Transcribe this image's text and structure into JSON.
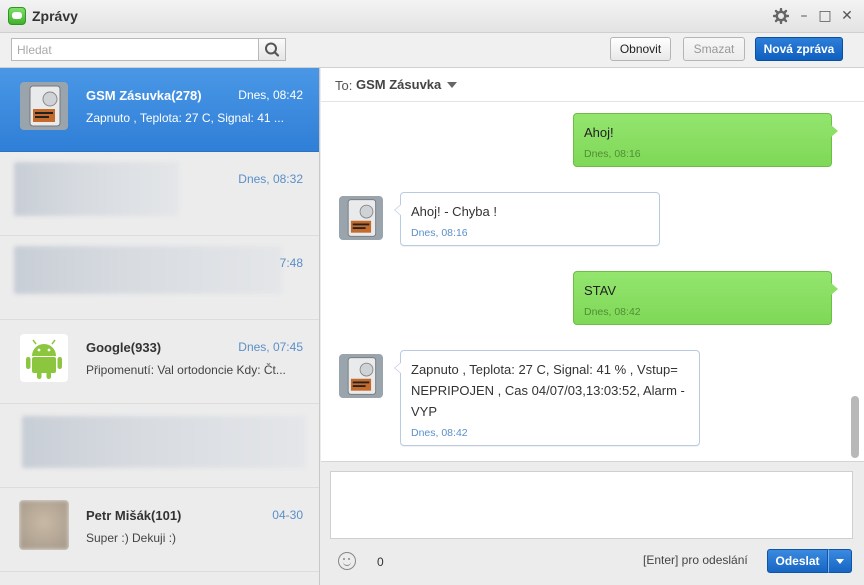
{
  "window": {
    "title": "Zprávy",
    "controls": {
      "settings_icon": "gear-icon",
      "minimize": "–",
      "maximize": "□",
      "close": "✕"
    }
  },
  "toolbar": {
    "search_placeholder": "Hledat",
    "refresh_label": "Obnovit",
    "delete_label": "Smazat",
    "new_message_label": "Nová zpráva"
  },
  "conversations": [
    {
      "name": "GSM Zásuvka(278)",
      "time": "Dnes, 08:42",
      "preview": "Zapnuto , Teplota: 27 C, Signal: 41 ...",
      "selected": true
    },
    {
      "name": "",
      "time": "Dnes, 08:32",
      "preview": "",
      "blurred": true
    },
    {
      "name": "",
      "time": "7:48",
      "preview": "",
      "blurred": true
    },
    {
      "name": "Google(933)",
      "time": "Dnes, 07:45",
      "preview": "Připomenutí: Val ortodoncie Kdy: Čt...",
      "avatar_icon": "android-icon"
    },
    {
      "name": "",
      "time": "",
      "preview": "",
      "blurred": true
    },
    {
      "name": "Petr Mišák(101)",
      "time": "04-30",
      "preview": "Super :) Dekuji :)"
    }
  ],
  "chat": {
    "to_label": "To:",
    "to_name": "GSM Zásuvka",
    "messages": [
      {
        "direction": "out",
        "text": "Ahoj!",
        "time": "Dnes, 08:16"
      },
      {
        "direction": "in",
        "text": "Ahoj! - Chyba !",
        "time": "Dnes, 08:16"
      },
      {
        "direction": "out",
        "text": "STAV",
        "time": "Dnes, 08:42"
      },
      {
        "direction": "in",
        "lines": [
          "Zapnuto , Teplota: 27 C, Signal: 41 % , Vstup=",
          "NEPRIPOJEN , Cas 04/07/03,13:03:52, Alarm -",
          "VYP"
        ],
        "time": "Dnes, 08:42"
      }
    ]
  },
  "compose": {
    "value": "",
    "char_count": "0",
    "send_hint": "[Enter] pro odeslání",
    "send_label": "Odeslat"
  },
  "colors": {
    "accent": "#2f7fd7",
    "outgoing_bubble": "#86dd60",
    "incoming_border": "#b9cbe0",
    "primary_button": "#1766c3"
  }
}
